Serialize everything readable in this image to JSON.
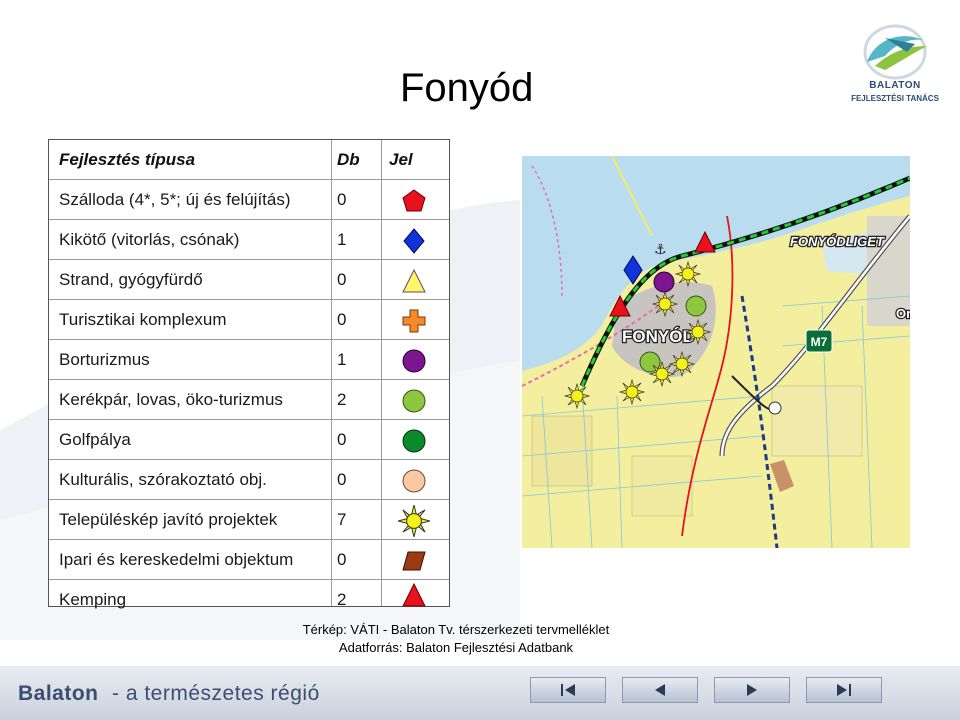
{
  "title": "Fonyód",
  "logo": {
    "line1": "BALATON",
    "line2": "FEJLESZTÉSI TANÁCS"
  },
  "legend": {
    "headers": {
      "type": "Fejlesztés típusa",
      "count": "Db",
      "symbol": "Jel"
    },
    "rows": [
      {
        "label": "Szálloda (4*, 5*; új és felújítás)",
        "count": "0",
        "symbol": "red-pentagon",
        "color": "#e8111c"
      },
      {
        "label": "Kikötő (vitorlás, csónak)",
        "count": "1",
        "symbol": "blue-diamond",
        "color": "#1133dd"
      },
      {
        "label": "Strand, gyógyfürdő",
        "count": "0",
        "symbol": "yellow-triangle",
        "color": "#fff46a"
      },
      {
        "label": "Turisztikai komplexum",
        "count": "0",
        "symbol": "orange-cross",
        "color": "#f68a2a"
      },
      {
        "label": "Borturizmus",
        "count": "1",
        "symbol": "purple-circle",
        "color": "#7d1590"
      },
      {
        "label": "Kerékpár, lovas, öko-turizmus",
        "count": "2",
        "symbol": "light-green-circle",
        "color": "#8ec63f"
      },
      {
        "label": "Golfpálya",
        "count": "0",
        "symbol": "dark-green-circle",
        "color": "#0b8a2c"
      },
      {
        "label": "Kulturális, szórakoztató obj.",
        "count": "0",
        "symbol": "peach-circle",
        "color": "#fac9a3"
      },
      {
        "label": "Településkép javító projektek",
        "count": "7",
        "symbol": "sun",
        "color": "#f5f21a"
      },
      {
        "label": "Ipari és kereskedelmi objektum",
        "count": "0",
        "symbol": "brown-parallelogram",
        "color": "#9a3a14"
      },
      {
        "label": "Kemping",
        "count": "2",
        "symbol": "red-triangle",
        "color": "#e8111c"
      }
    ]
  },
  "map": {
    "labels": {
      "town": "FONYÓD",
      "district": "FONYÓDLIGET",
      "road": "M7",
      "edge": "Or"
    }
  },
  "captions": {
    "line1": "Térkép: VÁTI - Balaton Tv. térszerkezeti tervmelléklet",
    "line2": "Adatforrás: Balaton Fejlesztési Adatbank"
  },
  "footer": {
    "brand": "Balaton",
    "slogan": "- a természetes régió",
    "nav": [
      "first-icon",
      "previous-icon",
      "back-icon",
      "forward-icon",
      "last-icon"
    ]
  }
}
